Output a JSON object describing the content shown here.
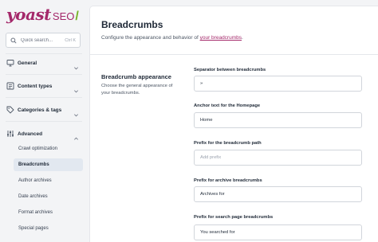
{
  "brand": {
    "name": "yoast",
    "product": "SEO",
    "slash": "/"
  },
  "search": {
    "placeholder": "Quick search...",
    "shortcut": "Ctrl K"
  },
  "nav": {
    "general": "General",
    "content_types": "Content types",
    "categories_tags": "Categories & tags",
    "advanced": "Advanced"
  },
  "advanced_items": [
    {
      "label": "Crawl optimization"
    },
    {
      "label": "Breadcrumbs"
    },
    {
      "label": "Author archives"
    },
    {
      "label": "Date archives"
    },
    {
      "label": "Format archives"
    },
    {
      "label": "Special pages"
    }
  ],
  "header": {
    "title": "Breadcrumbs",
    "description": "Configure the appearance and behavior of",
    "link_text": "your breadcrumbs",
    "description_end": "."
  },
  "section": {
    "title": "Breadcrumb appearance",
    "description": "Choose the general appearance of your breadcrumbs."
  },
  "fields": {
    "separator": {
      "label": "Separator between breadcrumbs",
      "value": "»"
    },
    "anchor": {
      "label": "Anchor text for the Homepage",
      "value": "Home"
    },
    "prefix_path": {
      "label": "Prefix for the breadcrumb path",
      "value": "",
      "placeholder": "Add prefix"
    },
    "prefix_archive": {
      "label": "Prefix for archive breadcrumbs",
      "value": "Archives for"
    },
    "prefix_search": {
      "label": "Prefix for search page breadcrumbs",
      "value": "You searched for"
    }
  },
  "colors": {
    "brand": "#a4286a",
    "accent": "#77b227",
    "active_bg": "#e2e8f0"
  }
}
